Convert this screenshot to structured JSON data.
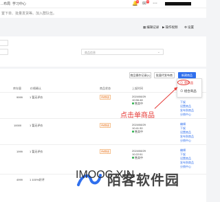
{
  "top": {
    "left1": "...布局",
    "left2": "学习中心",
    "notice": "置下单、批量发货等。加入群队伍。",
    "badge_count": "3",
    "bell_badge": "1"
  },
  "toolbar": {
    "btn1": "编辑记录",
    "btn2": "操作视频",
    "btn3": "设置"
  },
  "filters": {
    "field2_label": "商品信息"
  },
  "actions": {
    "a1": "商品操作记录(L)",
    "a2": "批量代发布商",
    "a3": "新建商品"
  },
  "table": {
    "headers": [
      "库存量",
      "价格确认",
      "商品状态",
      "上架时间",
      "操作"
    ],
    "rows": [
      {
        "stock": "9999",
        "price": "1  暂无评价",
        "tag": "待审核",
        "date": "2024/08/29",
        "time": "10:56:48",
        "status": "售卖中",
        "ops": [
          "编辑",
          "下架",
          "设置商品",
          "发布到商品",
          "分销中心"
        ]
      },
      {
        "stock": "10000",
        "price": "1  暂无评价",
        "tag": "待审核",
        "date": "2024/08/29",
        "time": "10:41:30",
        "status": "售卖中",
        "ops": [
          "编辑",
          "下架",
          "设置商品",
          "发布到商品",
          "分销中心"
        ]
      },
      {
        "stock": "1999",
        "price": "1  暂无评价",
        "tag": "待审核",
        "date": "2024/08/29",
        "time": "10:22:51",
        "status": "售卖中",
        "ops": [
          "编辑",
          "下架",
          "设置商品",
          "发布到商品",
          "分销中心"
        ]
      },
      {
        "stock": "4999",
        "price": "1  100%好评",
        "tag": "",
        "date": "",
        "time": "",
        "status": "",
        "ops": []
      }
    ]
  },
  "popup": {
    "item1": "单商品",
    "item2": "组合商品"
  },
  "annotation": "点击单商品",
  "watermark": {
    "main": "陌客软件园",
    "sub": "IMOOC.XIN"
  },
  "colors": {
    "primary": "#2f6fed",
    "accent_red": "#e53935",
    "tag_orange": "#e8711b",
    "status_green": "#2bb24c"
  }
}
